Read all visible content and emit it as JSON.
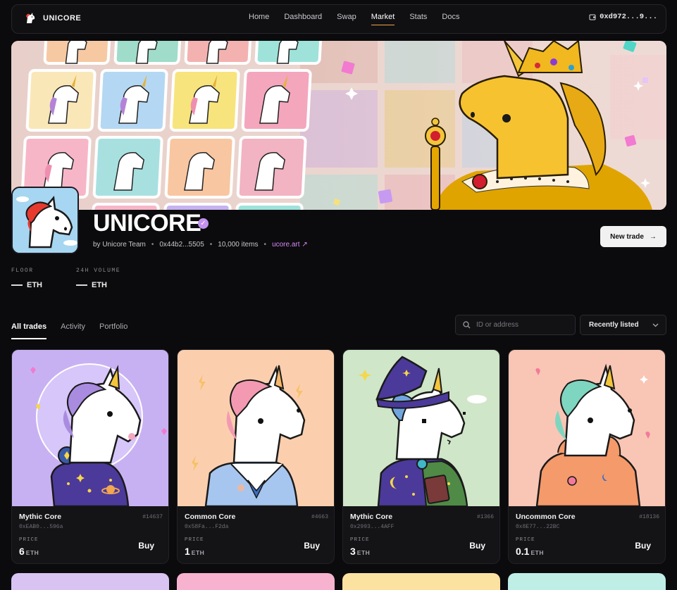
{
  "nav": {
    "brand": "UNICORE",
    "links": [
      "Home",
      "Dashboard",
      "Swap",
      "Market",
      "Stats",
      "Docs"
    ],
    "active_link": "Market",
    "wallet": "0xd972...9..."
  },
  "collection": {
    "title": "UNICORE",
    "by": "by Unicore Team",
    "contract": "0x44b2...5505",
    "items": "10,000 items",
    "website": "ucore.art",
    "new_trade_label": "New trade"
  },
  "stats": [
    {
      "label": "FLOOR",
      "value": "ETH"
    },
    {
      "label": "24H VOLUME",
      "value": "ETH"
    }
  ],
  "tabs": [
    "All trades",
    "Activity",
    "Portfolio"
  ],
  "active_tab": "All trades",
  "search": {
    "placeholder": "ID or address"
  },
  "sort": {
    "selected": "Recently listed"
  },
  "cards": [
    {
      "name": "Mythic Core",
      "id": "#14637",
      "address": "0xEAB0...596a",
      "price_label": "PRICE",
      "price": "6",
      "unit": "ETH",
      "buy": "Buy",
      "bg": "#c9b3f2"
    },
    {
      "name": "Common Core",
      "id": "#4663",
      "address": "0x58Fa...F2da",
      "price_label": "PRICE",
      "price": "1",
      "unit": "ETH",
      "buy": "Buy",
      "bg": "#fbcfb0"
    },
    {
      "name": "Mythic Core",
      "id": "#1366",
      "address": "0x2993...4AFF",
      "price_label": "PRICE",
      "price": "3",
      "unit": "ETH",
      "buy": "Buy",
      "bg": "#cfe5c7"
    },
    {
      "name": "Uncommon Core",
      "id": "#18136",
      "address": "0x8E77...22BC",
      "price_label": "PRICE",
      "price": "0.1",
      "unit": "ETH",
      "buy": "Buy",
      "bg": "#f9c6b6"
    }
  ],
  "colors": {
    "accent": "#f0a54a",
    "verified": "#c392f0",
    "link": "#d987f5"
  }
}
